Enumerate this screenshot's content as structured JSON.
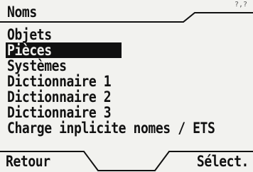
{
  "header": {
    "title": "Noms",
    "page_indicator": "?,?"
  },
  "menu": {
    "items": [
      {
        "label": "Objets",
        "selected": false
      },
      {
        "label": "Pièces",
        "selected": true
      },
      {
        "label": "Systèmes",
        "selected": false
      },
      {
        "label": "Dictionnaire 1",
        "selected": false
      },
      {
        "label": "Dictionnaire 2",
        "selected": false
      },
      {
        "label": "Dictionnaire 3",
        "selected": false
      },
      {
        "label": "Charge inplicite nomes / ETS",
        "selected": false
      }
    ]
  },
  "softkeys": {
    "left_label": "Retour",
    "right_label": "Sélect."
  },
  "colors": {
    "background": "#f2f2ef",
    "foreground": "#111111",
    "selection_background": "#111111",
    "selection_text": "#f2f2ef"
  }
}
